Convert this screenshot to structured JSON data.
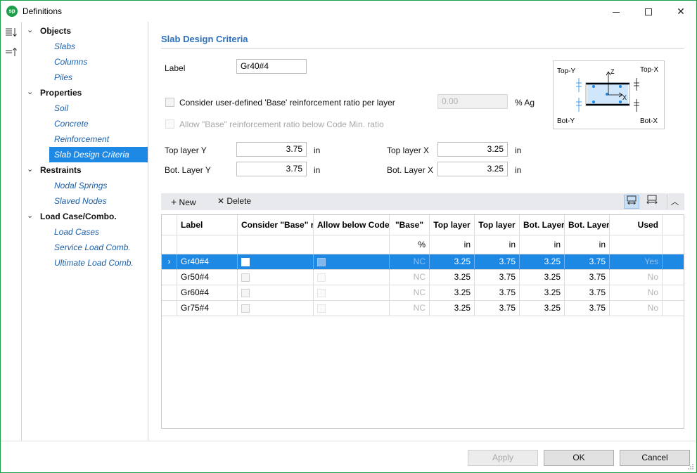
{
  "window": {
    "title": "Definitions",
    "logo_text": "sp"
  },
  "left_strip": {
    "expand_all_icon": "list-sort-down-icon",
    "collapse_all_icon": "list-sort-up-icon"
  },
  "nav": {
    "groups": [
      {
        "label": "Objects",
        "items": [
          "Slabs",
          "Columns",
          "Piles"
        ]
      },
      {
        "label": "Properties",
        "items": [
          "Soil",
          "Concrete",
          "Reinforcement",
          "Slab Design Criteria"
        ]
      },
      {
        "label": "Restraints",
        "items": [
          "Nodal Springs",
          "Slaved Nodes"
        ]
      },
      {
        "label": "Load Case/Combo.",
        "items": [
          "Load Cases",
          "Service Load Comb.",
          "Ultimate Load Comb."
        ]
      }
    ],
    "selected": "Slab Design Criteria"
  },
  "form": {
    "section_title": "Slab Design Criteria",
    "label_caption": "Label",
    "label_value": "Gr40#4",
    "consider_base_caption": "Consider user-defined 'Base' reinforcement ratio per layer",
    "base_ratio_value": "0.00",
    "base_ratio_unit": "% Ag",
    "allow_base_caption": "Allow \"Base\" reinforcement ratio below Code Min. ratio",
    "top_y_caption": "Top layer Y",
    "top_y_value": "3.75",
    "bot_y_caption": "Bot. Layer Y",
    "bot_y_value": "3.75",
    "top_x_caption": "Top layer X",
    "top_x_value": "3.25",
    "bot_x_caption": "Bot. Layer X",
    "bot_x_value": "3.25",
    "unit_in": "in"
  },
  "diagram": {
    "top_y": "Top-Y",
    "top_x": "Top-X",
    "bot_y": "Bot-Y",
    "bot_x": "Bot-X",
    "axis_z": "Z",
    "axis_x": "X"
  },
  "grid_toolbar": {
    "new_label": "New",
    "delete_label": "Delete",
    "new_icon": "plus-icon",
    "delete_icon": "x-icon"
  },
  "grid": {
    "headers": [
      "Label",
      "Consider \"Base\" r",
      "Allow below Code",
      "\"Base\"",
      "Top layer",
      "Top layer",
      "Bot. Layer",
      "Bot. Layer",
      "Used"
    ],
    "units": [
      "",
      "",
      "",
      "%",
      "in",
      "in",
      "in",
      "in",
      ""
    ],
    "rows": [
      {
        "label": "Gr40#4",
        "base": "NC",
        "top1": "3.25",
        "top2": "3.75",
        "bot1": "3.25",
        "bot2": "3.75",
        "used": "Yes"
      },
      {
        "label": "Gr50#4",
        "base": "NC",
        "top1": "3.25",
        "top2": "3.75",
        "bot1": "3.25",
        "bot2": "3.75",
        "used": "No"
      },
      {
        "label": "Gr60#4",
        "base": "NC",
        "top1": "3.25",
        "top2": "3.75",
        "bot1": "3.25",
        "bot2": "3.75",
        "used": "No"
      },
      {
        "label": "Gr75#4",
        "base": "NC",
        "top1": "3.25",
        "top2": "3.75",
        "bot1": "3.25",
        "bot2": "3.75",
        "used": "No"
      }
    ],
    "row_indicator": "›"
  },
  "footer": {
    "apply": "Apply",
    "ok": "OK",
    "cancel": "Cancel"
  },
  "colors": {
    "accent": "#1e88e5",
    "title_blue": "#2a6fb8",
    "nav_link": "#1c5fa8",
    "window_border": "#1aa04a"
  }
}
